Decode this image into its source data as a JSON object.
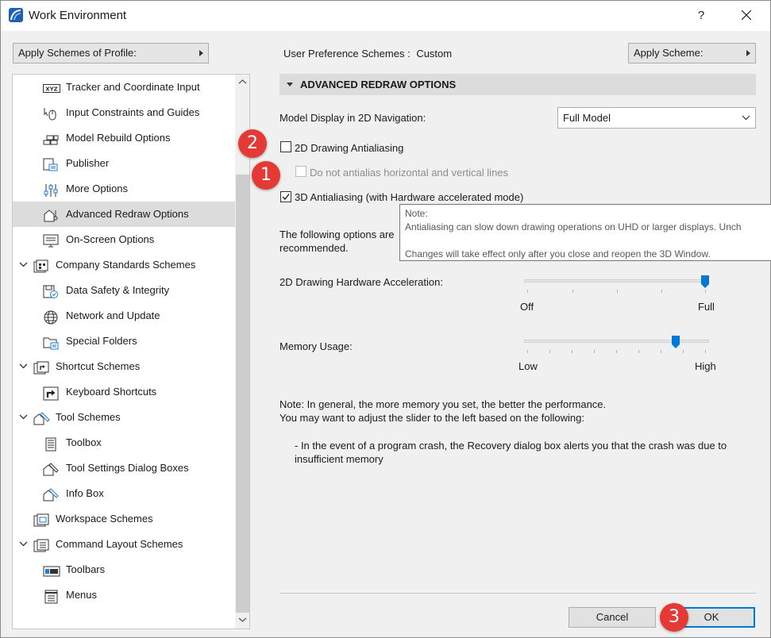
{
  "window": {
    "title": "Work Environment",
    "help": "?"
  },
  "top": {
    "apply_profile": "Apply Schemes of Profile:",
    "pref_schemes_label": "User Preference Schemes :",
    "pref_schemes_value": "Custom",
    "apply_scheme": "Apply Scheme:"
  },
  "tree": {
    "items": [
      {
        "label": "Tracker and Coordinate Input",
        "icon": "xyz-icon"
      },
      {
        "label": "Input Constraints and Guides",
        "icon": "mouse-constraint-icon"
      },
      {
        "label": "Model Rebuild Options",
        "icon": "bricks-icon"
      },
      {
        "label": "Publisher",
        "icon": "publisher-icon"
      },
      {
        "label": "More Options",
        "icon": "sliders-icon"
      },
      {
        "label": "Advanced Redraw Options",
        "icon": "redraw-icon"
      },
      {
        "label": "On-Screen Options",
        "icon": "monitor-icon"
      },
      {
        "label": "Company Standards Schemes",
        "icon": "company-icon"
      },
      {
        "label": "Data Safety & Integrity",
        "icon": "data-safety-icon"
      },
      {
        "label": "Network and Update",
        "icon": "globe-icon"
      },
      {
        "label": "Special Folders",
        "icon": "folder-icon"
      },
      {
        "label": "Shortcut Schemes",
        "icon": "shortcut-scheme-icon"
      },
      {
        "label": "Keyboard Shortcuts",
        "icon": "shortcut-arrow-icon"
      },
      {
        "label": "Tool Schemes",
        "icon": "tool-scheme-icon"
      },
      {
        "label": "Toolbox",
        "icon": "toolbox-icon"
      },
      {
        "label": "Tool Settings Dialog Boxes",
        "icon": "tool-settings-icon"
      },
      {
        "label": "Info Box",
        "icon": "info-box-icon"
      },
      {
        "label": "Workspace Schemes",
        "icon": "workspace-icon"
      },
      {
        "label": "Command Layout Schemes",
        "icon": "command-layout-icon"
      },
      {
        "label": "Toolbars",
        "icon": "toolbars-icon"
      },
      {
        "label": "Menus",
        "icon": "menus-icon"
      }
    ]
  },
  "panel": {
    "header": "ADVANCED REDRAW OPTIONS",
    "model_display_label": "Model Display in 2D Navigation:",
    "model_display_value": "Full Model",
    "cb_2d_aa": "2D Drawing Antialiasing",
    "cb_no_hv": "Do not antialias horizontal and vertical lines",
    "cb_3d_aa": "3D Antialiasing (with Hardware accelerated mode)",
    "following_line1": "The following options are",
    "following_line2": "recommended.",
    "hw_accel_label": "2D Drawing Hardware Acceleration:",
    "hw_off": "Off",
    "hw_full": "Full",
    "hw_level": 1.0,
    "memory_label": "Memory Usage:",
    "mem_low": "Low",
    "mem_high": "High",
    "mem_level": 0.82,
    "note1": "Note: In general, the more memory you set, the better the performance.",
    "note2": "You may want to adjust the slider to the left based on the following:",
    "bullet1": "- In the event of a program crash, the Recovery dialog box alerts you that the crash was due to",
    "bullet2": "insufficient memory"
  },
  "tooltip": {
    "title": "Note:",
    "line1": "Antialiasing can slow down drawing operations on UHD or larger displays. Unch",
    "line2": "Changes will take effect only after you close and reopen the 3D Window."
  },
  "buttons": {
    "cancel": "Cancel",
    "ok": "OK"
  },
  "badges": {
    "one": "1",
    "two": "2",
    "three": "3"
  },
  "colors": {
    "accent": "#0078d7",
    "badge": "#e53935",
    "selected": "#dcdcdc"
  }
}
